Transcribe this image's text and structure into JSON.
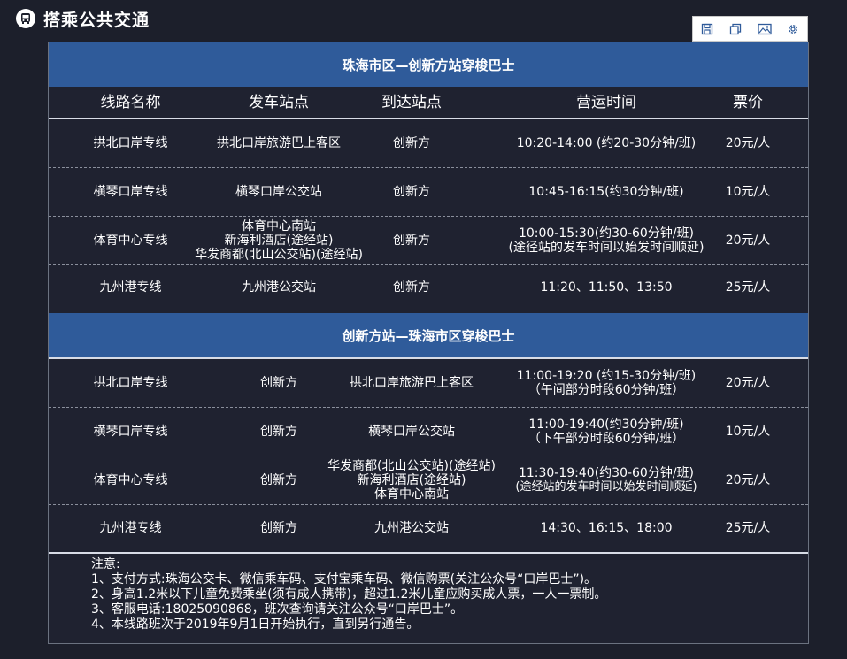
{
  "header": {
    "title": "搭乘公共交通",
    "icon": "bus-icon"
  },
  "toolbar": {
    "buttons": [
      {
        "name": "save-icon",
        "label": "保存"
      },
      {
        "name": "copy-icon",
        "label": "复制"
      },
      {
        "name": "image-icon",
        "label": "图片"
      },
      {
        "name": "gear-icon",
        "label": "设置"
      }
    ]
  },
  "columns": [
    "线路名称",
    "发车站点",
    "到达站点",
    "营运时间",
    "票价"
  ],
  "sections": [
    {
      "title": "珠海市区—创新方站穿梭巴士",
      "rows": [
        {
          "route": "拱北口岸专线",
          "from": [
            "拱北口岸旅游巴上客区"
          ],
          "to": [
            "创新方"
          ],
          "time": [
            "10:20-14:00 (约20-30分钟/班)"
          ],
          "price": "20元/人"
        },
        {
          "route": "横琴口岸专线",
          "from": [
            "横琴口岸公交站"
          ],
          "to": [
            "创新方"
          ],
          "time": [
            "10:45-16:15(约30分钟/班)"
          ],
          "price": "10元/人"
        },
        {
          "route": "体育中心专线",
          "from": [
            "体育中心南站",
            "新海利酒店(途经站)",
            "华发商都(北山公交站)(途经站)"
          ],
          "to": [
            "创新方"
          ],
          "time": [
            "10:00-15:30(约30-60分钟/班)",
            "(途径站的发车时间以始发时间顺延)"
          ],
          "price": "20元/人"
        },
        {
          "route": "九州港专线",
          "from": [
            "九州港公交站"
          ],
          "to": [
            "创新方"
          ],
          "time": [
            "11:20、11:50、13:50"
          ],
          "price": "25元/人"
        }
      ]
    },
    {
      "title": "创新方站—珠海市区穿梭巴士",
      "rows": [
        {
          "route": "拱北口岸专线",
          "from": [
            "创新方"
          ],
          "to": [
            "拱北口岸旅游巴上客区"
          ],
          "time": [
            "11:00-19:20 (约15-30分钟/班)",
            "（午间部分时段60分钟/班）"
          ],
          "price": "20元/人"
        },
        {
          "route": "横琴口岸专线",
          "from": [
            "创新方"
          ],
          "to": [
            "横琴口岸公交站"
          ],
          "time": [
            "11:00-19:40(约30分钟/班)",
            "（下午部分时段60分钟/班）"
          ],
          "price": "10元/人"
        },
        {
          "route": "体育中心专线",
          "from": [
            "创新方"
          ],
          "to": [
            "华发商都(北山公交站)(途经站)",
            "新海利酒店(途经站)",
            "体育中心南站"
          ],
          "time": [
            "11:30-19:40(约30-60分钟/班)",
            "(途经站的发车时间以始发时间顺延)"
          ],
          "price": "20元/人"
        },
        {
          "route": "九州港专线",
          "from": [
            "创新方"
          ],
          "to": [
            "九州港公交站"
          ],
          "time": [
            "14:30、16:15、18:00"
          ],
          "price": "25元/人"
        }
      ]
    }
  ],
  "notes": {
    "title": "注意:",
    "items": [
      "1、支付方式:珠海公交卡、微信乘车码、支付宝乘车码、微信购票(关注公众号“口岸巴士”)。",
      "2、身高1.2米以下儿童免费乘坐(须有成人携带)，超过1.2米儿童应购买成人票，一人一票制。",
      "3、客服电话:18025090868，班次查询请关注公众号“口岸巴士”。",
      "4、本线路班次于2019年9月1日开始执行，直到另行通告。"
    ]
  },
  "colors": {
    "background": "#1c1f2b",
    "section_header": "#2f5b9a",
    "text": "#ffffff"
  }
}
